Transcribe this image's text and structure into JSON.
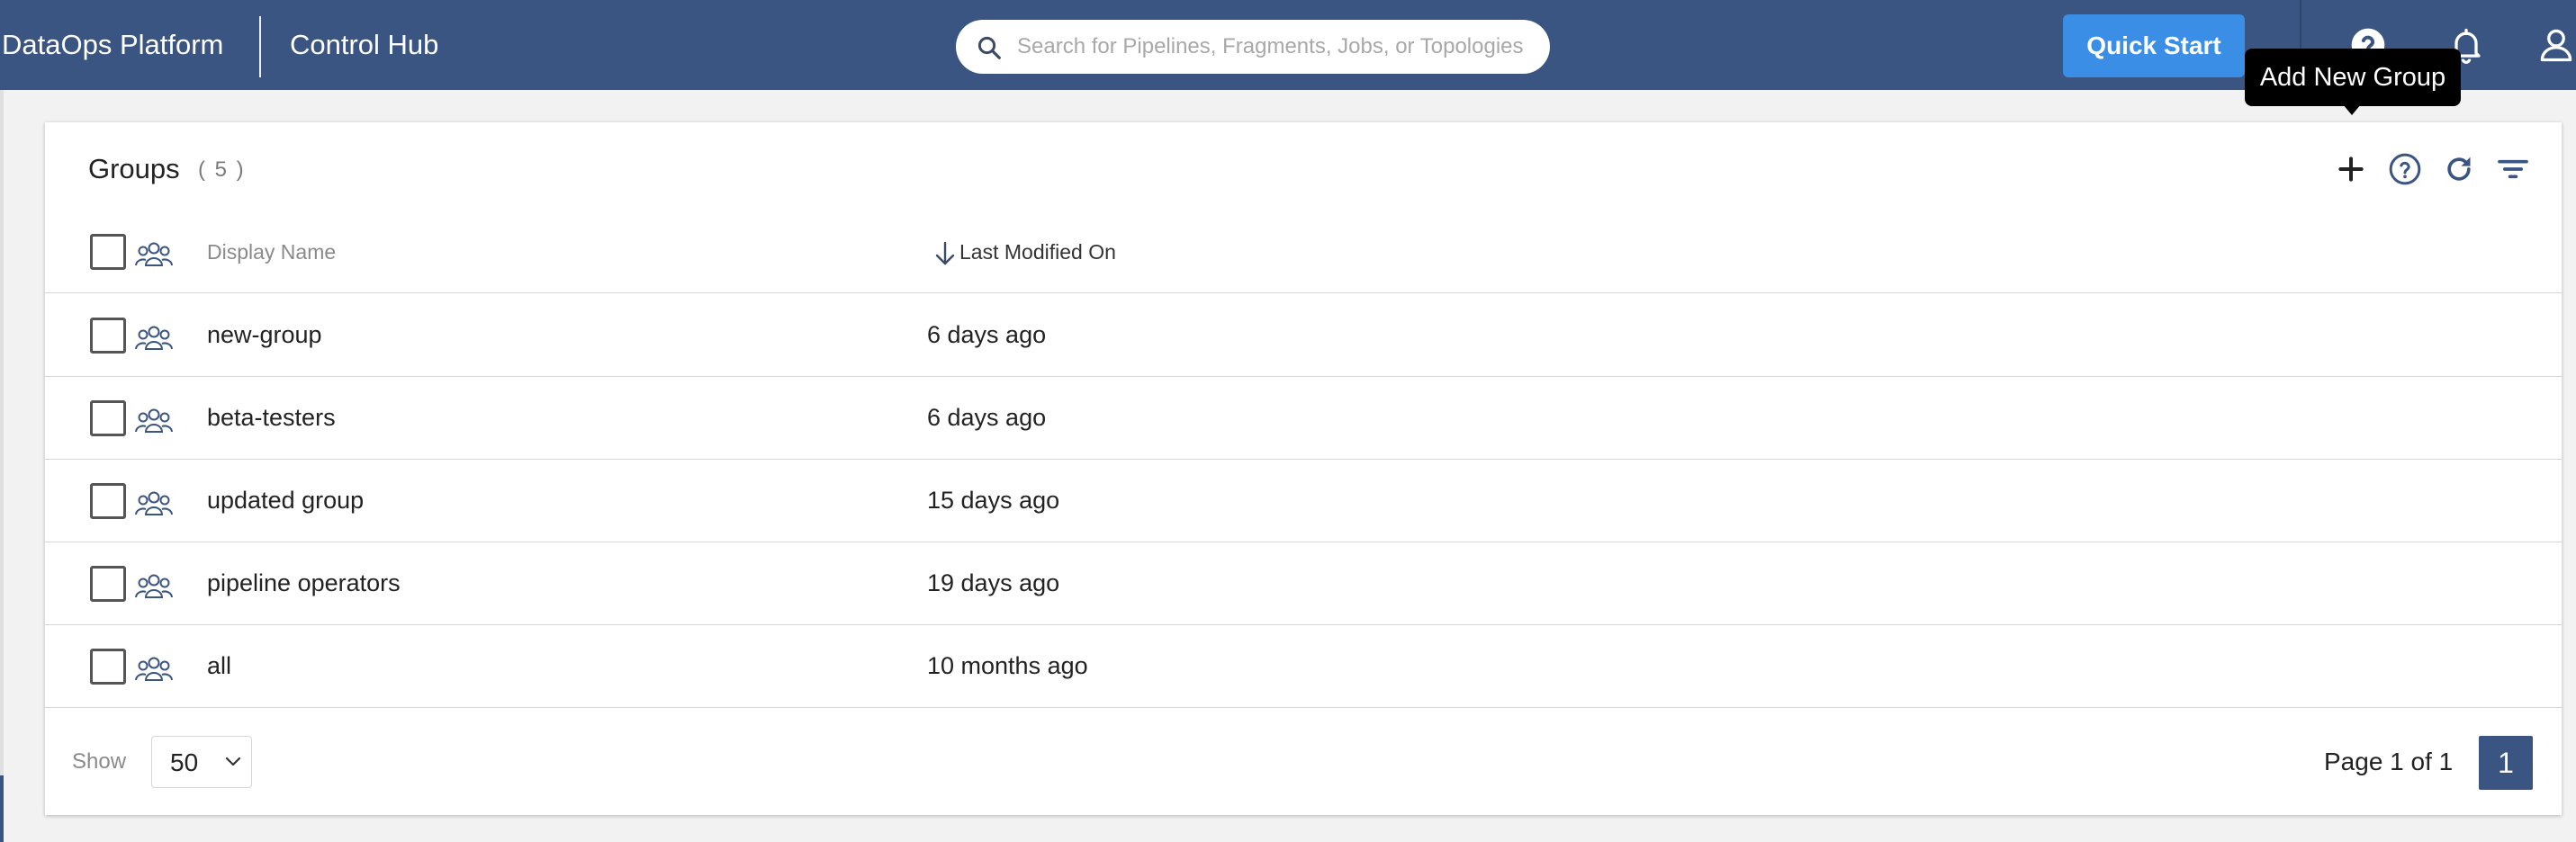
{
  "topbar": {
    "brand": "DataOps Platform",
    "app_name": "Control Hub",
    "search_placeholder": "Search for Pipelines, Fragments, Jobs, or Topologies",
    "quick_start_label": "Quick Start",
    "icons": [
      "help-icon",
      "bell-icon",
      "user-icon"
    ]
  },
  "groups": {
    "title": "Groups",
    "count": "( 5 )",
    "toolbar_icons": [
      "plus-icon",
      "help-circle-icon",
      "refresh-icon",
      "filter-icon"
    ],
    "tooltip": "Add New Group",
    "columns": {
      "name": "Display Name",
      "modified": "Last Modified On"
    },
    "rows": [
      {
        "name": "new-group",
        "modified": "6 days ago"
      },
      {
        "name": "beta-testers",
        "modified": "6 days ago"
      },
      {
        "name": "updated group",
        "modified": "15 days ago"
      },
      {
        "name": "pipeline operators",
        "modified": "19 days ago"
      },
      {
        "name": "all",
        "modified": "10 months ago"
      }
    ]
  },
  "footer": {
    "show_label": "Show",
    "page_size": "50",
    "page_info": "Page 1 of 1",
    "current_page": "1"
  },
  "colors": {
    "topbar": "#3b5583",
    "accent_button": "#3a8ee6",
    "pagination": "#3b5583"
  }
}
